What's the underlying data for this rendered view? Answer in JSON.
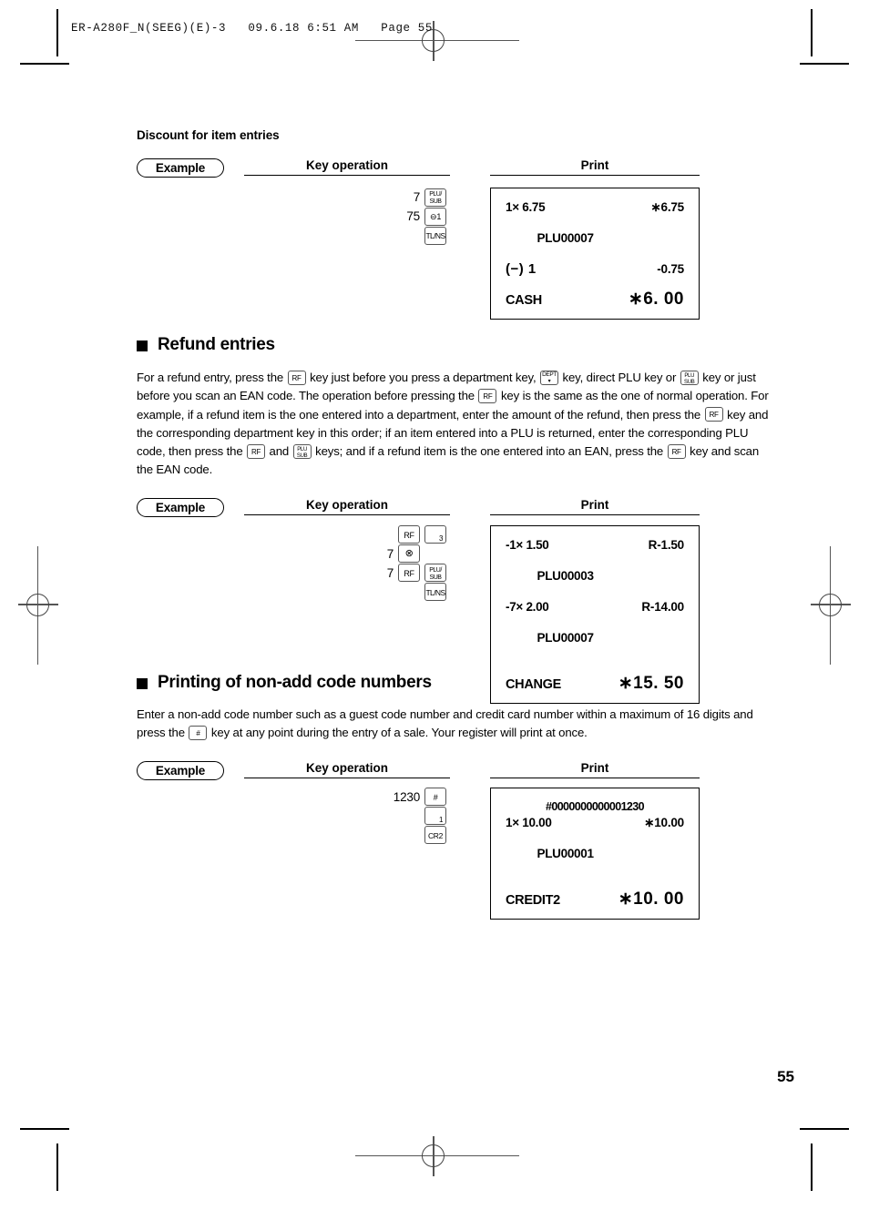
{
  "header": {
    "file_info": "ER-A280F_N(SEEG)(E)-3   09.6.18 6:51 AM   Page 55"
  },
  "footer": {
    "page_number": "55"
  },
  "sections": [
    {
      "id": "discount-for-item-entries",
      "subheading": "Discount for item entries",
      "example": {
        "badge": "Example",
        "key_operation_header": "Key operation",
        "print_header": "Print",
        "key_operation": [
          {
            "number": "7",
            "keys": [
              {
                "name": "plu-sub-key",
                "lines": [
                  "PLU/",
                  "SUB"
                ]
              }
            ]
          },
          {
            "number": "75",
            "keys": [
              {
                "name": "minus-1-key",
                "lines": [
                  "⊖ 1"
                ]
              }
            ]
          },
          {
            "number": "",
            "keys": [
              {
                "name": "tl-ns-key",
                "lines": [
                  "TL/NS"
                ]
              }
            ]
          }
        ],
        "receipt": [
          {
            "left": "1× 6.75",
            "right": "∗6.75"
          },
          {
            "left": "PLU00007",
            "right": ""
          },
          {
            "left": "(−) 1",
            "right": "-0.75",
            "style": "minus"
          },
          {
            "gap": true
          },
          {
            "left": "CASH",
            "right": "∗6. 00",
            "style": "total"
          }
        ]
      }
    },
    {
      "id": "refund-entries",
      "heading": "Refund entries",
      "body_parts": [
        {
          "t": "text",
          "v": "For a refund entry, press the "
        },
        {
          "t": "key",
          "name": "rf-key",
          "lines": [
            "RF"
          ]
        },
        {
          "t": "text",
          "v": " key just before you press a department key, "
        },
        {
          "t": "key",
          "name": "dept-key",
          "lines": [
            "DEPT",
            "▾"
          ],
          "variant": "dept"
        },
        {
          "t": "text",
          "v": " key, direct PLU key or "
        },
        {
          "t": "key",
          "name": "plu-sub-key",
          "lines": [
            "PLU",
            "SUB"
          ]
        },
        {
          "t": "text",
          "v": " key or just before you scan an EAN code.  The operation before pressing the "
        },
        {
          "t": "key",
          "name": "rf-key",
          "lines": [
            "RF"
          ]
        },
        {
          "t": "text",
          "v": " key is the same as the one of normal operation.  For example, if a refund item is the one entered into a department, enter the amount of the refund, then press the "
        },
        {
          "t": "key",
          "name": "rf-key",
          "lines": [
            "RF"
          ]
        },
        {
          "t": "text",
          "v": " key and the corresponding department key in this order; if an item entered into a PLU is returned, enter the corresponding PLU code, then press the "
        },
        {
          "t": "key",
          "name": "rf-key",
          "lines": [
            "RF"
          ]
        },
        {
          "t": "text",
          "v": " and "
        },
        {
          "t": "key",
          "name": "plu-sub-key",
          "lines": [
            "PLU",
            "SUB"
          ]
        },
        {
          "t": "text",
          "v": " keys; and if a refund item is the one entered into an EAN, press the "
        },
        {
          "t": "key",
          "name": "rf-key",
          "lines": [
            "RF"
          ]
        },
        {
          "t": "text",
          "v": " key and scan the EAN code."
        }
      ],
      "example": {
        "badge": "Example",
        "key_operation_header": "Key operation",
        "print_header": "Print",
        "key_operation": [
          {
            "number": "",
            "keys": [
              {
                "name": "rf-key",
                "lines": [
                  "RF"
                ]
              },
              {
                "name": "plu-3-key",
                "lines": [
                  "3"
                ],
                "variant": "num"
              }
            ]
          },
          {
            "number": "7",
            "keys": [
              {
                "name": "multiply-key",
                "lines": [
                  "⊗"
                ],
                "variant": "sym"
              }
            ]
          },
          {
            "number": "7",
            "keys": [
              {
                "name": "rf-key",
                "lines": [
                  "RF"
                ]
              },
              {
                "name": "plu-sub-key",
                "lines": [
                  "PLU/",
                  "SUB"
                ]
              }
            ]
          },
          {
            "number": "",
            "keys": [
              {
                "name": "tl-ns-key",
                "lines": [
                  "TL/NS"
                ]
              }
            ]
          }
        ],
        "receipt": [
          {
            "left": "-1× 1.50",
            "right": "R-1.50"
          },
          {
            "left": "PLU00003",
            "right": ""
          },
          {
            "left": "-7× 2.00",
            "right": "R-14.00"
          },
          {
            "left": "PLU00007",
            "right": ""
          },
          {
            "gap": true
          },
          {
            "left": "CHANGE",
            "right": "∗15. 50",
            "style": "total"
          }
        ]
      }
    },
    {
      "id": "printing-of-non-add-code-numbers",
      "heading": "Printing of non-add code numbers",
      "body_parts": [
        {
          "t": "text",
          "v": "Enter a non-add code number such as a guest code number and credit card number within a maximum of 16 digits and press the "
        },
        {
          "t": "key",
          "name": "hash-key",
          "lines": [
            "#"
          ]
        },
        {
          "t": "text",
          "v": " key at any point during the entry of a sale.  Your register will print at once."
        }
      ],
      "example": {
        "badge": "Example",
        "key_operation_header": "Key operation",
        "print_header": "Print",
        "key_operation": [
          {
            "number": "1230",
            "keys": [
              {
                "name": "hash-key",
                "lines": [
                  "#"
                ]
              }
            ]
          },
          {
            "number": "",
            "keys": [
              {
                "name": "plu-1-key",
                "lines": [
                  "1"
                ],
                "variant": "num"
              }
            ]
          },
          {
            "number": "",
            "keys": [
              {
                "name": "cr2-key",
                "lines": [
                  "CR2"
                ],
                "variant": "cr2"
              }
            ]
          }
        ],
        "receipt": [
          {
            "center": "#0000000000001230"
          },
          {
            "left": "1× 10.00",
            "right": "∗10.00"
          },
          {
            "left": "PLU00001",
            "right": ""
          },
          {
            "gap": true
          },
          {
            "left": "CREDIT2",
            "right": "∗10. 00",
            "style": "total"
          }
        ]
      }
    }
  ]
}
